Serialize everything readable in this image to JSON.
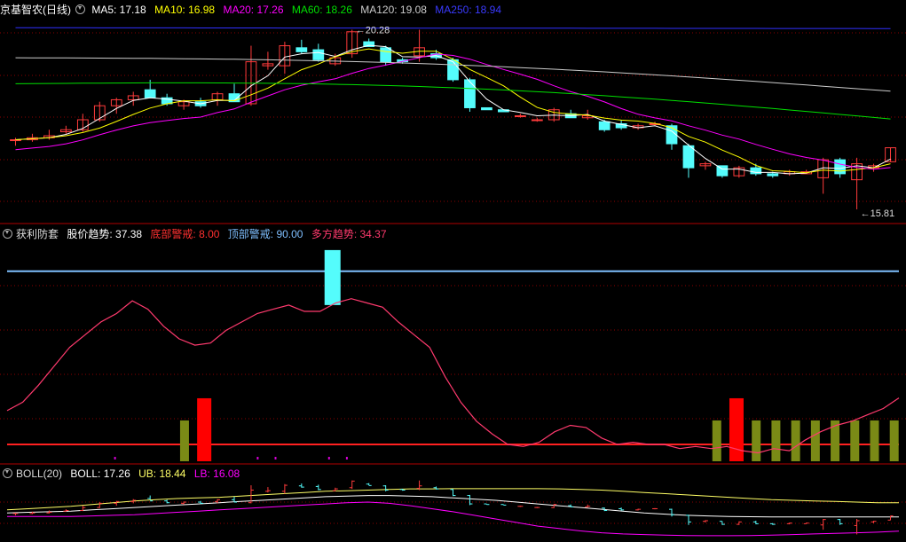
{
  "colors": {
    "up": "#ff3b3b",
    "down": "#54fcfc",
    "ma5": "#ffffff",
    "ma10": "#ffff00",
    "ma20": "#ff00ff",
    "ma60": "#00e000",
    "ma120": "#cccccc",
    "ma250": "#3030ff",
    "grid": "#8b0000",
    "trend": "#ff3a6e",
    "top": "#7fbfff",
    "bottom": "#ff2020",
    "olive": "#7a8a16",
    "boll_mid": "#ffffff",
    "boll_ub": "#ffff66",
    "boll_lb": "#ff00ff"
  },
  "panel1": {
    "title": "京基智农(日线)",
    "ma5": "MA5: 17.18",
    "ma10": "MA10: 16.98",
    "ma20": "MA20: 17.26",
    "ma60": "MA60: 18.26",
    "ma120": "MA120: 19.08",
    "ma250": "MA250: 18.94",
    "high_label": "20.28",
    "low_label": "15.81"
  },
  "panel2": {
    "title": "获利防套",
    "trend": "股价趋势: 37.38",
    "bottom": "底部警戒: 8.00",
    "top": "顶部警戒: 90.00",
    "multi": "多方趋势: 34.37"
  },
  "panel3": {
    "title": "BOLL(20)",
    "boll": "BOLL: 17.26",
    "ub": "UB: 18.44",
    "lb": "LB: 16.08"
  },
  "chart_data": [
    {
      "type": "candlestick",
      "price_range": [
        15.5,
        20.6
      ],
      "candles": [
        [
          17.55,
          17.6,
          17.4,
          17.55
        ],
        [
          17.55,
          17.7,
          17.5,
          17.6
        ],
        [
          17.6,
          17.8,
          17.55,
          17.65
        ],
        [
          17.75,
          17.9,
          17.7,
          17.8
        ],
        [
          17.8,
          18.2,
          17.75,
          18.05
        ],
        [
          18.05,
          18.5,
          18.0,
          18.4
        ],
        [
          18.4,
          18.6,
          18.2,
          18.55
        ],
        [
          18.55,
          18.75,
          18.4,
          18.65
        ],
        [
          18.8,
          19.05,
          18.7,
          18.6
        ],
        [
          18.6,
          18.7,
          18.4,
          18.45
        ],
        [
          18.4,
          18.55,
          18.3,
          18.5
        ],
        [
          18.5,
          18.6,
          18.35,
          18.4
        ],
        [
          18.55,
          18.75,
          18.4,
          18.7
        ],
        [
          18.7,
          18.95,
          18.5,
          18.5
        ],
        [
          18.45,
          19.9,
          18.4,
          19.5
        ],
        [
          19.4,
          19.75,
          19.3,
          19.45
        ],
        [
          19.4,
          20.0,
          19.2,
          19.9
        ],
        [
          19.85,
          20.05,
          19.7,
          19.75
        ],
        [
          19.8,
          19.95,
          19.5,
          19.55
        ],
        [
          19.45,
          19.7,
          19.4,
          19.6
        ],
        [
          19.7,
          20.3,
          19.6,
          20.25
        ],
        [
          20.0,
          20.08,
          19.9,
          19.88
        ],
        [
          19.85,
          19.9,
          19.4,
          19.5
        ],
        [
          19.55,
          19.6,
          19.45,
          19.5
        ],
        [
          19.65,
          20.3,
          19.5,
          19.85
        ],
        [
          19.7,
          19.8,
          19.55,
          19.6
        ],
        [
          19.55,
          19.6,
          19.0,
          19.05
        ],
        [
          19.05,
          19.1,
          18.25,
          18.35
        ],
        [
          18.35,
          18.35,
          18.3,
          18.3
        ],
        [
          18.3,
          18.3,
          18.25,
          18.25
        ],
        [
          18.15,
          18.2,
          18.1,
          18.15
        ],
        [
          18.05,
          18.1,
          18.0,
          18.05
        ],
        [
          18.05,
          18.35,
          18.0,
          18.3
        ],
        [
          18.2,
          18.3,
          18.1,
          18.1
        ],
        [
          18.1,
          18.3,
          18.05,
          18.15
        ],
        [
          18.0,
          18.05,
          17.75,
          17.8
        ],
        [
          17.95,
          18.05,
          17.8,
          17.85
        ],
        [
          17.85,
          17.95,
          17.8,
          17.9
        ],
        [
          17.95,
          18.0,
          17.9,
          17.95
        ],
        [
          17.9,
          17.95,
          17.3,
          17.45
        ],
        [
          17.4,
          17.45,
          16.6,
          16.85
        ],
        [
          16.9,
          17.0,
          16.8,
          16.95
        ],
        [
          16.9,
          16.9,
          16.6,
          16.65
        ],
        [
          16.65,
          16.9,
          16.6,
          16.85
        ],
        [
          16.85,
          16.95,
          16.65,
          16.7
        ],
        [
          16.7,
          16.75,
          16.6,
          16.65
        ],
        [
          16.7,
          16.8,
          16.65,
          16.75
        ],
        [
          16.7,
          16.8,
          16.7,
          16.75
        ],
        [
          16.6,
          17.1,
          16.2,
          17.05
        ],
        [
          17.05,
          17.1,
          16.6,
          16.7
        ],
        [
          16.55,
          17.1,
          15.81,
          16.95
        ],
        [
          16.85,
          16.95,
          16.75,
          16.9
        ],
        [
          17.0,
          17.35,
          17.0,
          17.35
        ]
      ]
    },
    {
      "type": "line",
      "range": [
        0,
        100
      ],
      "trend": [
        24,
        28,
        36,
        45,
        54,
        60,
        66,
        70,
        76,
        72,
        64,
        58,
        55,
        56,
        62,
        66,
        70,
        72,
        74,
        71,
        71,
        75,
        77,
        75,
        73,
        66,
        60,
        54,
        40,
        28,
        19,
        13,
        8,
        7,
        9,
        14,
        17,
        16,
        11,
        8,
        9,
        8,
        8,
        6,
        7,
        6,
        7,
        5,
        4,
        6,
        5,
        10,
        14,
        17,
        19,
        22,
        25,
        30
      ],
      "top_line": 90,
      "bottom_line": 8,
      "warning_bar": [
        74,
        95
      ],
      "bars_red": [
        10,
        37,
        47
      ],
      "bars_olive": [
        9,
        36,
        38,
        39,
        40,
        41,
        42,
        43,
        44,
        45
      ],
      "bar_range": [
        0,
        17
      ]
    },
    {
      "type": "line",
      "range": [
        15.4,
        20.2
      ],
      "ub": [
        17.85,
        17.95,
        18.05,
        18.15,
        18.3,
        18.45,
        18.6,
        18.7,
        18.8,
        18.85,
        18.9,
        19.0,
        19.1,
        19.2,
        19.3,
        19.4,
        19.45,
        19.5,
        19.55,
        19.6,
        19.6,
        19.62,
        19.62,
        19.62,
        19.62,
        19.62,
        19.6,
        19.55,
        19.5,
        19.4,
        19.3,
        19.2,
        19.1,
        19.0,
        18.9,
        18.8,
        18.7,
        18.65,
        18.6,
        18.55,
        18.5,
        18.45,
        18.44
      ],
      "mid": [
        17.6,
        17.65,
        17.7,
        17.75,
        17.85,
        17.95,
        18.05,
        18.15,
        18.25,
        18.35,
        18.45,
        18.55,
        18.65,
        18.75,
        18.85,
        18.95,
        19.0,
        19.05,
        19.05,
        19.0,
        18.95,
        18.85,
        18.75,
        18.65,
        18.5,
        18.35,
        18.2,
        18.05,
        17.9,
        17.75,
        17.6,
        17.5,
        17.4,
        17.35,
        17.3,
        17.28,
        17.26,
        17.26,
        17.26,
        17.26,
        17.26,
        17.26,
        17.26
      ],
      "lb": [
        17.3,
        17.3,
        17.3,
        17.3,
        17.35,
        17.4,
        17.45,
        17.55,
        17.65,
        17.75,
        17.85,
        17.95,
        18.05,
        18.15,
        18.25,
        18.35,
        18.45,
        18.5,
        18.4,
        18.2,
        17.95,
        17.7,
        17.4,
        17.1,
        16.8,
        16.5,
        16.3,
        16.1,
        15.95,
        15.85,
        15.8,
        15.75,
        15.72,
        15.7,
        15.7,
        15.72,
        15.75,
        15.8,
        15.85,
        15.9,
        15.95,
        16.0,
        16.08
      ]
    }
  ]
}
